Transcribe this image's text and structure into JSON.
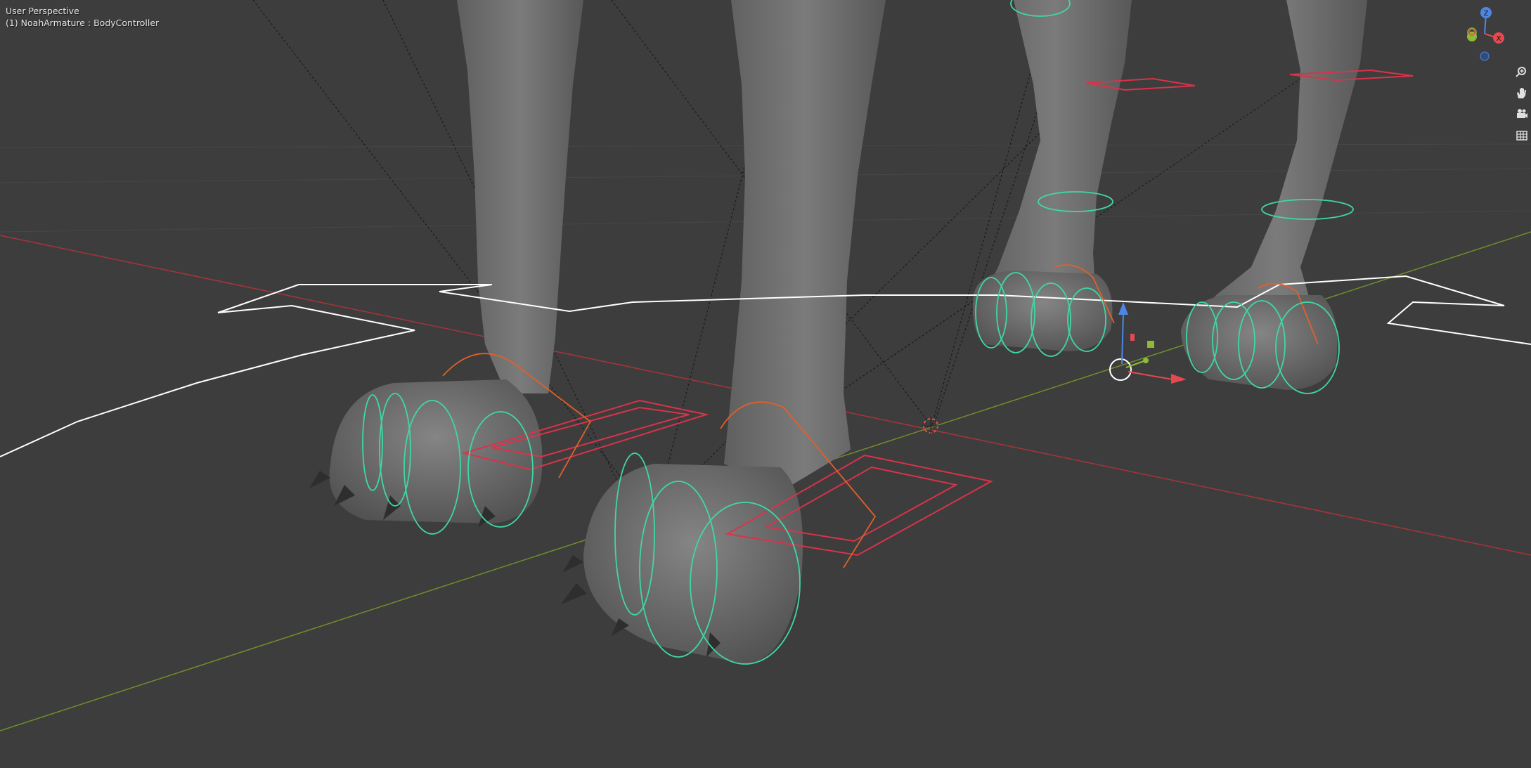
{
  "viewport": {
    "mode": "User Perspective",
    "active_object": "(1) NoahArmature : BodyController"
  },
  "navigation_gizmo": {
    "axes": [
      "Z",
      "X"
    ]
  },
  "tools": [
    {
      "icon": "magnifier-zoom-icon"
    },
    {
      "icon": "hand-pan-icon"
    },
    {
      "icon": "camera-view-icon"
    },
    {
      "icon": "grid-ortho-toggle-icon"
    }
  ],
  "colors": {
    "background": "#3d3d3d",
    "mesh": "#707070",
    "x_axis": "#c0393f",
    "y_axis": "#7b9c2e",
    "bone_green": "#3fd7a7",
    "bone_orange": "#f0702c",
    "bone_red": "#e63448",
    "root_white": "#ffffff"
  }
}
